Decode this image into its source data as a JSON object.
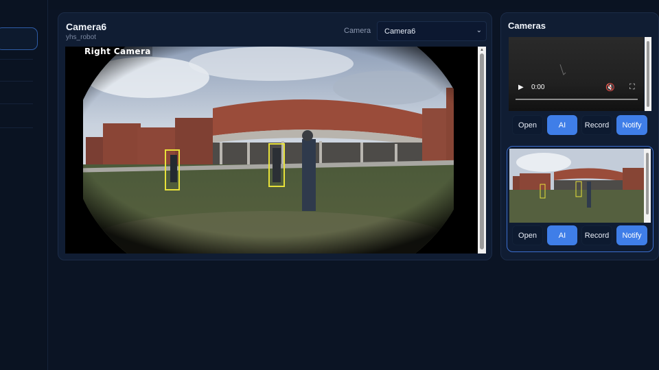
{
  "main": {
    "title": "Camera6",
    "subtitle": "yhs_robot",
    "camera_label": "Camera",
    "camera_selected": "Camera6",
    "overlay_label": "Right Camera"
  },
  "cameras_panel": {
    "title": "Cameras",
    "card1": {
      "time": "0:00",
      "buttons": [
        {
          "label": "Open",
          "active": false
        },
        {
          "label": "AI",
          "active": true
        },
        {
          "label": "Record",
          "active": false
        },
        {
          "label": "Notify",
          "active": true
        }
      ]
    },
    "card2": {
      "buttons": [
        {
          "label": "Open",
          "active": false
        },
        {
          "label": "AI",
          "active": true
        },
        {
          "label": "Record",
          "active": false
        },
        {
          "label": "Notify",
          "active": true
        }
      ]
    }
  },
  "icons": {
    "play": "play-icon",
    "mute": "mute-icon",
    "fullscreen": "fullscreen-icon",
    "select": "chevron-down-icon"
  },
  "colors": {
    "background": "#0b1424",
    "panel": "#101d33",
    "accent": "#3f7ee8",
    "detection_box": "#e8e23a"
  }
}
